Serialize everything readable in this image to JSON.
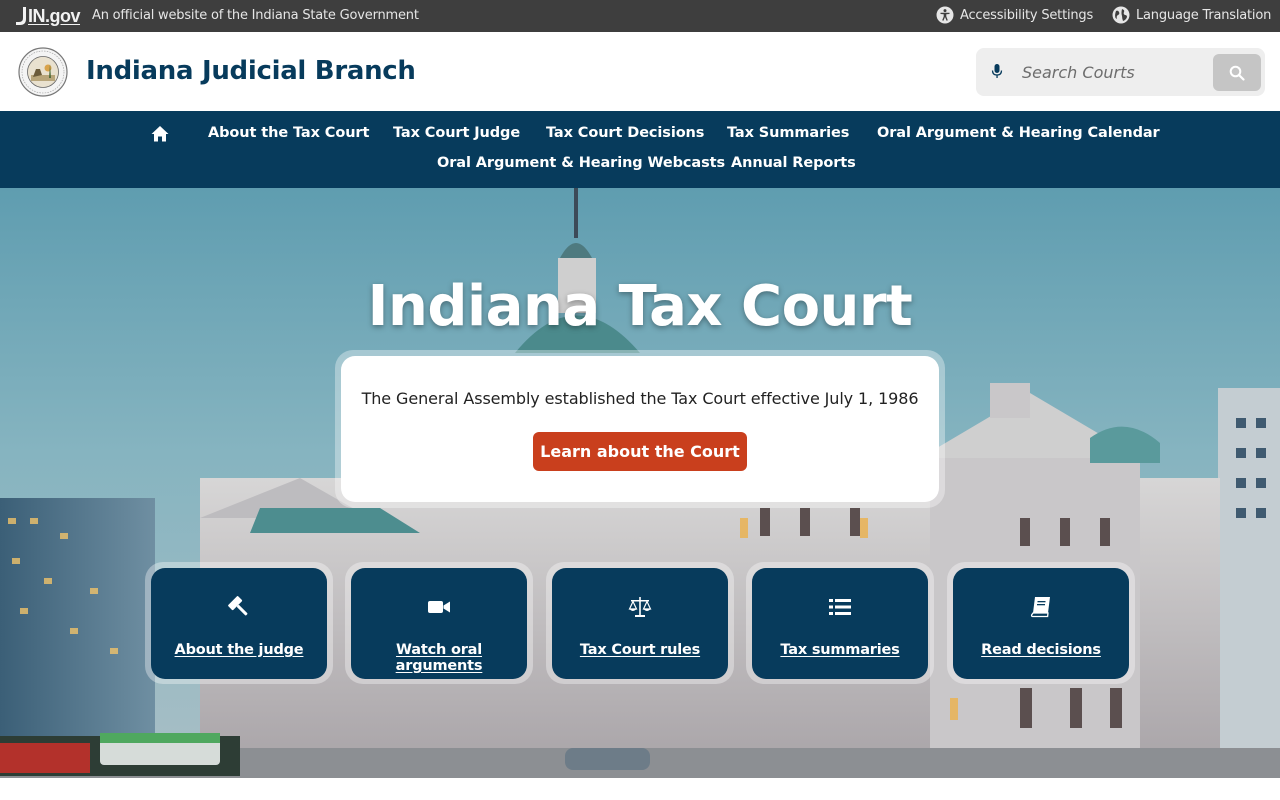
{
  "state_bar": {
    "logo_text": "IN.gov",
    "official_text": "An official website of the Indiana State Government",
    "accessibility_label": "Accessibility Settings",
    "language_label": "Language Translation"
  },
  "header": {
    "site_title": "Indiana Judicial Branch",
    "search_placeholder": "Search Courts"
  },
  "nav": {
    "items": [
      "About the Tax Court",
      "Tax Court Judge",
      "Tax Court Decisions",
      "Tax Summaries",
      "Oral Argument & Hearing Calendar",
      "Oral Argument & Hearing Webcasts",
      "Annual Reports"
    ]
  },
  "hero": {
    "title": "Indiana Tax Court",
    "intro_text": "The General Assembly established the Tax Court effective July 1, 1986",
    "cta_label": "Learn about the Court"
  },
  "quick_links": [
    {
      "label": "About the judge",
      "icon": "gavel-icon"
    },
    {
      "label": "Watch oral arguments",
      "icon": "video-camera-icon"
    },
    {
      "label": "Tax Court rules",
      "icon": "scales-icon"
    },
    {
      "label": "Tax summaries",
      "icon": "list-icon"
    },
    {
      "label": "Read decisions",
      "icon": "book-icon"
    }
  ],
  "colors": {
    "state_bar": "#3e3e3e",
    "brand_navy": "#073b5c",
    "cta_orange": "#c93f1d"
  }
}
